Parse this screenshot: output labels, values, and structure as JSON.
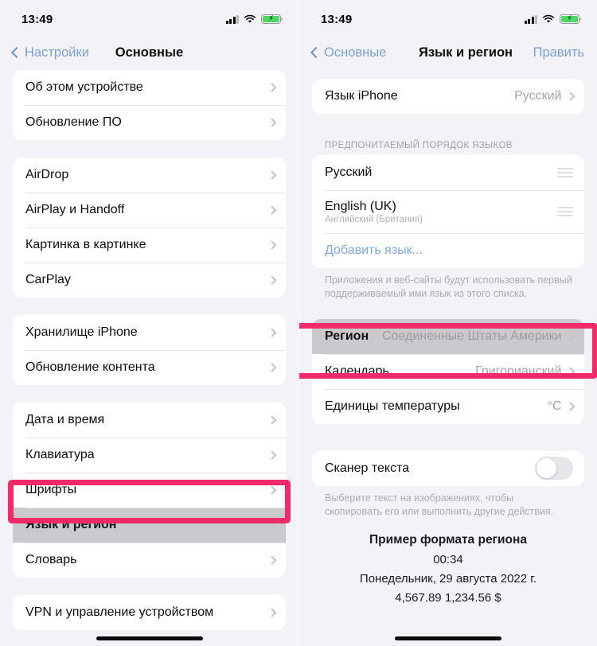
{
  "left_phone": {
    "status_bar": {
      "time": "13:49",
      "cellular_icon": "cellular-bars-icon",
      "wifi_icon": "wifi-icon",
      "battery_icon": "battery-charging-icon"
    },
    "nav": {
      "back_label": "Настройки",
      "title": "Основные"
    },
    "groups": [
      {
        "rows": [
          {
            "label": "Об этом устройстве"
          },
          {
            "label": "Обновление ПО"
          }
        ]
      },
      {
        "rows": [
          {
            "label": "AirDrop"
          },
          {
            "label": "AirPlay и Handoff"
          },
          {
            "label": "Картинка в картинке"
          },
          {
            "label": "CarPlay"
          }
        ]
      },
      {
        "rows": [
          {
            "label": "Хранилище iPhone"
          },
          {
            "label": "Обновление контента"
          }
        ]
      },
      {
        "rows": [
          {
            "label": "Дата и время"
          },
          {
            "label": "Клавиатура"
          },
          {
            "label": "Шрифты"
          },
          {
            "label": "Язык и регион"
          },
          {
            "label": "Словарь"
          }
        ]
      },
      {
        "rows": [
          {
            "label": "VPN и управление устройством"
          }
        ]
      }
    ],
    "highlight_color": "#f22a69"
  },
  "right_phone": {
    "status_bar": {
      "time": "13:49",
      "cellular_icon": "cellular-bars-icon",
      "wifi_icon": "wifi-icon",
      "battery_icon": "battery-charging-icon"
    },
    "nav": {
      "back_label": "Основные",
      "title": "Язык и регион",
      "edit_label": "Править"
    },
    "iphone_language": {
      "label": "Язык iPhone",
      "value": "Русский"
    },
    "preferred_order": {
      "header": "ПРЕДПОЧИТАЕМЫЙ ПОРЯДОК ЯЗЫКОВ",
      "languages": [
        {
          "label": "Русский",
          "sub": ""
        },
        {
          "label": "English (UK)",
          "sub": "Английский (Британия)"
        }
      ],
      "add_language": "Добавить язык...",
      "footnote": "Приложения и веб-сайты будут использовать первый поддерживаемый ими язык из этого списка."
    },
    "region_group": [
      {
        "label": "Регион",
        "value": "Соединенные Штаты Америки",
        "selected": true
      },
      {
        "label": "Календарь",
        "value": "Григорианский",
        "selected": false
      },
      {
        "label": "Единицы температуры",
        "value": "°C",
        "selected": false
      }
    ],
    "text_scanner": {
      "label": "Сканер текста",
      "toggle_state": "off",
      "footnote": "Выберите текст на изображениях, чтобы скопировать его или выполнить другие действия."
    },
    "sample": {
      "title": "Пример формата региона",
      "time": "00:34",
      "date": "Понедельник, 29 августа 2022 г.",
      "numbers": "4,567.89 1,234.56 $"
    },
    "highlight_color": "#f22a69"
  }
}
